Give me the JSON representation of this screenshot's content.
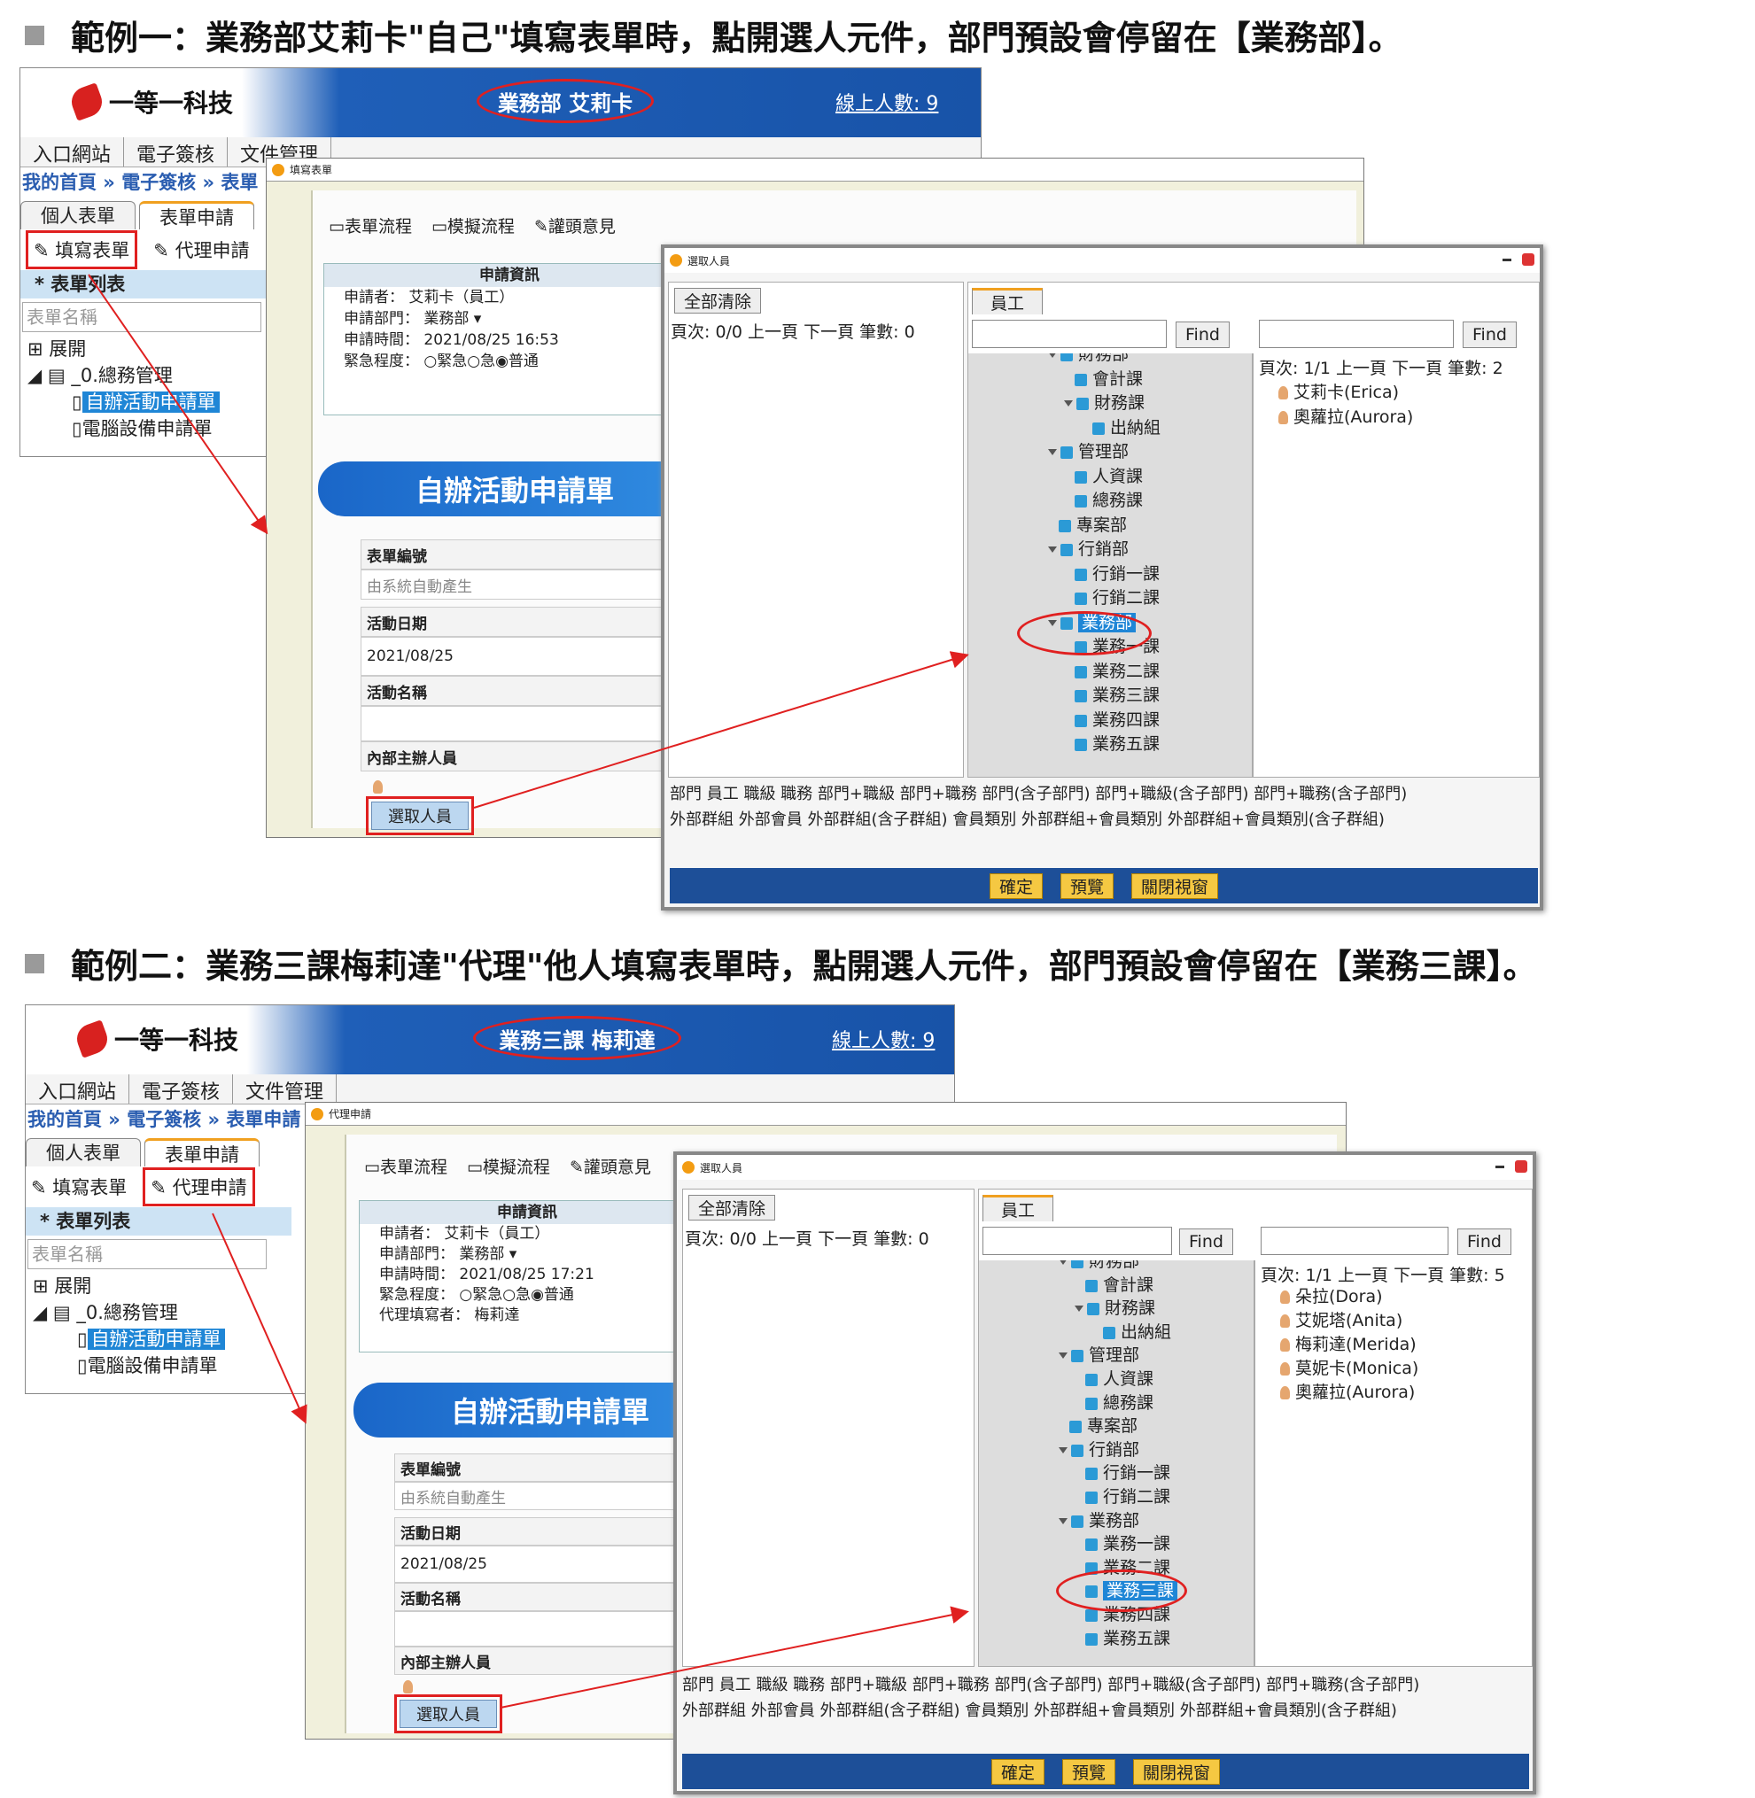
{
  "ex1": {
    "heading": "範例一：業務部艾莉卡\"自己\"填寫表單時，點開選人元件，部門預設會停留在【業務部】。",
    "company": "一等一科技",
    "user": "業務部 艾莉卡",
    "online_label": "線上人數",
    "online_count": ": 9",
    "menu": [
      "入口網站",
      "電子簽核",
      "文件管理"
    ],
    "crumb": "我的首頁 » 電子簽核 » 表單",
    "tabs": [
      "個人表單",
      "表單申請"
    ],
    "actions": [
      "填寫表單",
      "代理申請"
    ],
    "list_header": "* 表單列表",
    "search_placeholder": "表單名稱",
    "tree": [
      "展開",
      "_0.總務管理",
      "自辦活動申請單",
      "電腦設備申請單"
    ],
    "form_window_title": "填寫表單",
    "toolbar": [
      "表單流程",
      "模擬流程",
      "讙頭意見"
    ],
    "info_title": "申請資訊",
    "info": [
      "申請者：  艾莉卡（員工）",
      "申請部門：  業務部 ▾",
      "申請時間：  2021/08/25 16:53",
      "緊急程度：  ○緊急○急◉普通"
    ],
    "form_title": "自辦活動申請單",
    "rows": [
      "表單編號",
      "由系統自動產生",
      "活動日期",
      "2021/08/25",
      "活動名稱",
      "內部主辦人員"
    ],
    "pick_button": "選取人員",
    "dialog": {
      "title": "選取人員",
      "clear": "全部清除",
      "employee_tab": "員工",
      "left_pager": "頁次: 0/0  上一頁  下一頁  筆數: 0",
      "find": "Find",
      "right_pager": "頁次: 1/1  上一頁  下一頁  筆數: 2",
      "people": [
        "艾莉卡(Erica)",
        "奧蘿拉(Aurora)"
      ],
      "tree": [
        "財務部",
        "會計課",
        "財務課",
        "出納組",
        "管理部",
        "人資課",
        "總務課",
        "專案部",
        "行銷部",
        "行銷一課",
        "行銷二課",
        "業務部",
        "業務一課",
        "業務二課",
        "業務三課",
        "業務四課",
        "業務五課"
      ],
      "legend1": "部門 員工 職級 職務 部門+職級 部門+職務 部門(含子部門) 部門+職級(含子部門) 部門+職務(含子部門)",
      "legend2": "外部群組 外部會員 外部群組(含子群組) 會員類別 外部群組+會員類別 外部群組+會員類別(含子群組)",
      "buttons": [
        "確定",
        "預覽",
        "關閉視窗"
      ]
    }
  },
  "ex2": {
    "heading": "範例二：業務三課梅莉達\"代理\"他人填寫表單時，點開選人元件，部門預設會停留在【業務三課】。",
    "company": "一等一科技",
    "user": "業務三課 梅莉達",
    "online_label": "線上人數",
    "online_count": ": 9",
    "menu": [
      "入口網站",
      "電子簽核",
      "文件管理"
    ],
    "crumb": "我的首頁 » 電子簽核 » 表單申請",
    "tabs": [
      "個人表單",
      "表單申請"
    ],
    "actions": [
      "填寫表單",
      "代理申請"
    ],
    "list_header": "* 表單列表",
    "search_placeholder": "表單名稱",
    "tree": [
      "展開",
      "_0.總務管理",
      "自辦活動申請單",
      "電腦設備申請單"
    ],
    "form_window_title": "代理申請",
    "toolbar": [
      "表單流程",
      "模擬流程",
      "讙頭意見"
    ],
    "info_title": "申請資訊",
    "info": [
      "申請者：  艾莉卡（員工）",
      "申請部門：  業務部 ▾",
      "申請時間：  2021/08/25 17:21",
      "緊急程度：  ○緊急○急◉普通",
      "代理填寫者：  梅莉達"
    ],
    "form_title": "自辦活動申請單",
    "rows": [
      "表單編號",
      "由系統自動產生",
      "活動日期",
      "2021/08/25",
      "活動名稱",
      "內部主辦人員"
    ],
    "pick_button": "選取人員",
    "dialog": {
      "title": "選取人員",
      "clear": "全部清除",
      "employee_tab": "員工",
      "left_pager": "頁次: 0/0  上一頁  下一頁  筆數: 0",
      "find": "Find",
      "right_pager": "頁次: 1/1  上一頁  下一頁  筆數: 5",
      "people": [
        "朵拉(Dora)",
        "艾妮塔(Anita)",
        "梅莉達(Merida)",
        "莫妮卡(Monica)",
        "奧蘿拉(Aurora)"
      ],
      "tree": [
        "財務部",
        "會計課",
        "財務課",
        "出納組",
        "管理部",
        "人資課",
        "總務課",
        "專案部",
        "行銷部",
        "行銷一課",
        "行銷二課",
        "業務部",
        "業務一課",
        "業務二課",
        "業務三課",
        "業務四課",
        "業務五課"
      ],
      "legend1": "部門 員工 職級 職務 部門+職級 部門+職務 部門(含子部門) 部門+職級(含子部門) 部門+職務(含子部門)",
      "legend2": "外部群組 外部會員 外部群組(含子群組) 會員類別 外部群組+會員類別 外部群組+會員類別(含子群組)",
      "buttons": [
        "確定",
        "預覽",
        "關閉視窗"
      ]
    }
  }
}
